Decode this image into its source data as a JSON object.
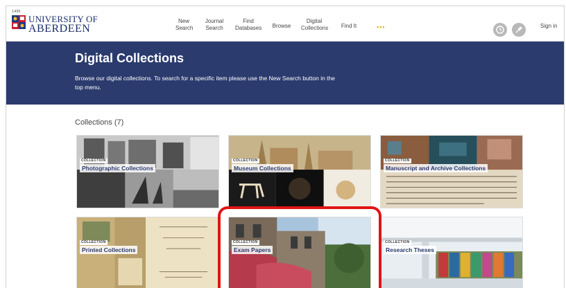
{
  "logo": {
    "year": "1495",
    "line1": "UNIVERSITY OF",
    "line2": "ABERDEEN"
  },
  "nav": {
    "new_search": [
      "New",
      "Search"
    ],
    "journal_search": [
      "Journal",
      "Search"
    ],
    "find_databases": [
      "Find",
      "Databases"
    ],
    "browse": "Browse",
    "digital_collections": [
      "Digital",
      "Collections"
    ],
    "find_it": "Find It",
    "more": "•••",
    "sign_in": "Sign in"
  },
  "icons": {
    "history": "history-icon",
    "pin": "pin-icon"
  },
  "banner": {
    "title": "Digital Collections",
    "description": "Browse our digital collections. To search for a specific item please use the New Search button in the top menu."
  },
  "collections": {
    "heading": "Collections (7)",
    "tag_label": "COLLECTION",
    "items": [
      {
        "title": "Photographic Collections"
      },
      {
        "title": "Museum Collections"
      },
      {
        "title": "Manuscript and Archive Collections"
      },
      {
        "title": "Printed Collections"
      },
      {
        "title": "Exam Papers"
      },
      {
        "title": "Research Theses"
      }
    ]
  },
  "colors": {
    "banner": "#2b3b6e",
    "highlight": "#e01414",
    "brand": "#1b2d6b"
  }
}
